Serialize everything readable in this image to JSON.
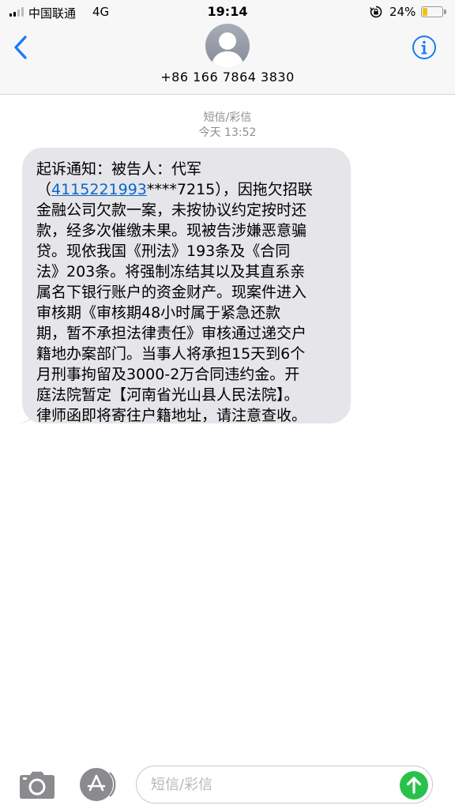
{
  "status_bar": {
    "carrier": "中国联通",
    "network": "4G",
    "time": "19:14",
    "battery_percent": "24%",
    "battery_level": 0.24,
    "battery_color": "#f3c019"
  },
  "header": {
    "contact_number": "+86 166 7864 3830",
    "back_icon": "chevron-left-icon",
    "info_icon": "info-circle-icon",
    "accent_color": "#1a7bf2"
  },
  "conversation": {
    "service_label": "短信/彩信",
    "timestamp": "今天 13:52",
    "message": {
      "lines": [
        "起诉通知：被告人：代军",
        {
          "prefix": "（",
          "link": "4115221993",
          "suffix": "****7215），因拖欠招联"
        },
        "金融公司欠款一案，未按协议约定按时还",
        "款，经多次催缴未果。现被告涉嫌恶意骗",
        "贷。现依我国《刑法》193条及《合同",
        "法》203条。将强制冻结其以及其直系亲",
        "属名下银行账户的资金财产。现案件进入",
        "审核期《审核期48小时属于紧急还款",
        "期，暂不承担法律责任》审核通过递交户",
        "籍地办案部门。当事人将承担15天到6个",
        "月刑事拘留及3000-2万合同违约金。开",
        "庭法院暂定【河南省光山县人民法院】。",
        "律师函即将寄往户籍地址，请注意查收。"
      ],
      "bubble_color": "#e5e5ea",
      "link_color": "#0a66c8"
    }
  },
  "input_bar": {
    "placeholder": "短信/彩信",
    "camera_icon": "camera-icon",
    "apps_icon": "app-store-icon",
    "send_icon": "send-arrow-icon",
    "send_color": "#28c24b"
  }
}
